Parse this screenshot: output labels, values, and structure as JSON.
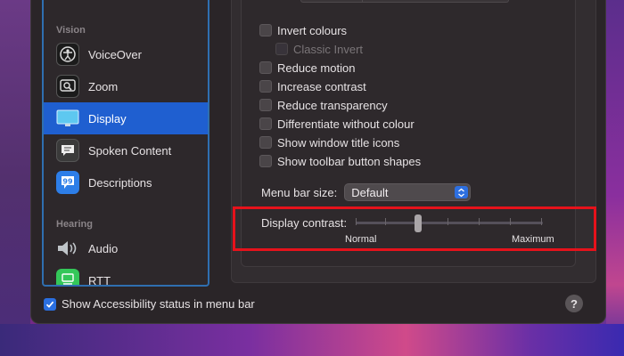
{
  "sidebar": {
    "sections": [
      {
        "label": "Vision"
      },
      {
        "label": "Hearing"
      }
    ],
    "items": [
      {
        "label": "VoiceOver",
        "icon": "voiceover-icon"
      },
      {
        "label": "Zoom",
        "icon": "zoom-icon"
      },
      {
        "label": "Display",
        "icon": "display-icon",
        "selected": true
      },
      {
        "label": "Spoken Content",
        "icon": "spoken-content-icon"
      },
      {
        "label": "Descriptions",
        "icon": "descriptions-icon"
      },
      {
        "label": "Audio",
        "icon": "audio-icon"
      },
      {
        "label": "RTT",
        "icon": "rtt-icon"
      }
    ]
  },
  "display": {
    "options": [
      {
        "label": "Invert colours",
        "checked": false
      },
      {
        "label": "Classic Invert",
        "checked": false,
        "disabled": true
      },
      {
        "label": "Reduce motion",
        "checked": false
      },
      {
        "label": "Increase contrast",
        "checked": false
      },
      {
        "label": "Reduce transparency",
        "checked": false
      },
      {
        "label": "Differentiate without colour",
        "checked": false
      },
      {
        "label": "Show window title icons",
        "checked": false
      },
      {
        "label": "Show toolbar button shapes",
        "checked": false
      }
    ],
    "menu_bar_size": {
      "label": "Menu bar size:",
      "value": "Default"
    },
    "contrast": {
      "label": "Display contrast:",
      "min_label": "Normal",
      "max_label": "Maximum",
      "value_fraction": 0.3
    }
  },
  "footer": {
    "status_checkbox_label": "Show Accessibility status in menu bar",
    "status_checked": true,
    "help_label": "?"
  },
  "colors": {
    "accent": "#1f5fd0",
    "highlight_box": "#e6121b"
  }
}
